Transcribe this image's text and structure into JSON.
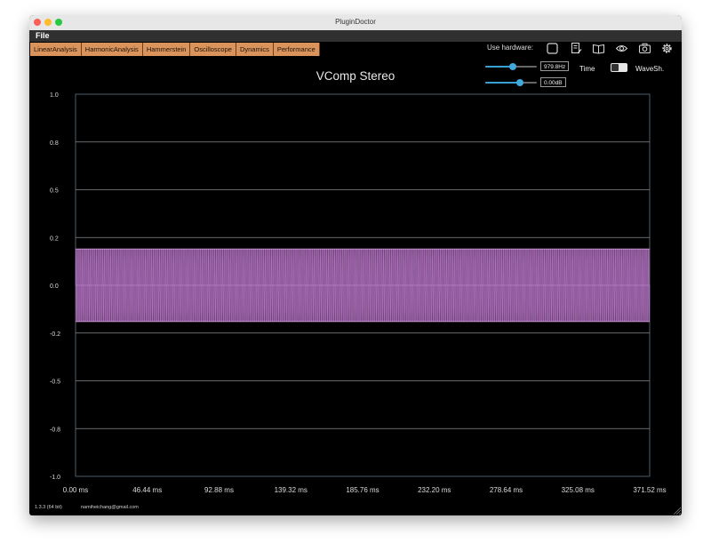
{
  "window": {
    "title": "PluginDoctor"
  },
  "menu": {
    "file": "File"
  },
  "tabs": [
    "LinearAnalysis",
    "HarmonicAnalysis",
    "Hammerstein",
    "Oscilloscope",
    "Dynamics",
    "Performance"
  ],
  "toolbar": {
    "use_hardware_label": "Use hardware:",
    "icons": [
      "checkbox-icon",
      "notes-icon",
      "book-icon",
      "eye-icon",
      "camera-icon",
      "gear-icon"
    ]
  },
  "controls": {
    "frequency": {
      "value": "979.8Hz",
      "position": 0.53
    },
    "gain": {
      "value": "0.00dB",
      "position": 0.68
    },
    "time_label": "Time",
    "waveshaper_label": "WaveSh."
  },
  "chart_data": {
    "type": "line",
    "title": "VComp Stereo",
    "xlabel": "",
    "ylabel": "",
    "x_ticks": [
      "0.00 ms",
      "46.44 ms",
      "92.88 ms",
      "139.32 ms",
      "185.76 ms",
      "232.20 ms",
      "278.64 ms",
      "325.08 ms",
      "371.52 ms"
    ],
    "y_ticks": [
      "1.0",
      "0.8",
      "0.5",
      "0.2",
      "0.0",
      "-0.2",
      "-0.5",
      "-0.8",
      "-1.0"
    ],
    "xlim": [
      0,
      371.52
    ],
    "ylim": [
      -1.0,
      1.0
    ],
    "grid": true,
    "series": [
      {
        "color": "#c980d8",
        "amplitude": 0.19,
        "frequency_hz": 979.8
      }
    ]
  },
  "status": {
    "version": "1.3.3 (64 bit)",
    "email": "namiheichang@gmail.com"
  },
  "colors": {
    "waveform": "#c980d8",
    "accent": "#3fa9e0",
    "tab": "#d9935b"
  }
}
